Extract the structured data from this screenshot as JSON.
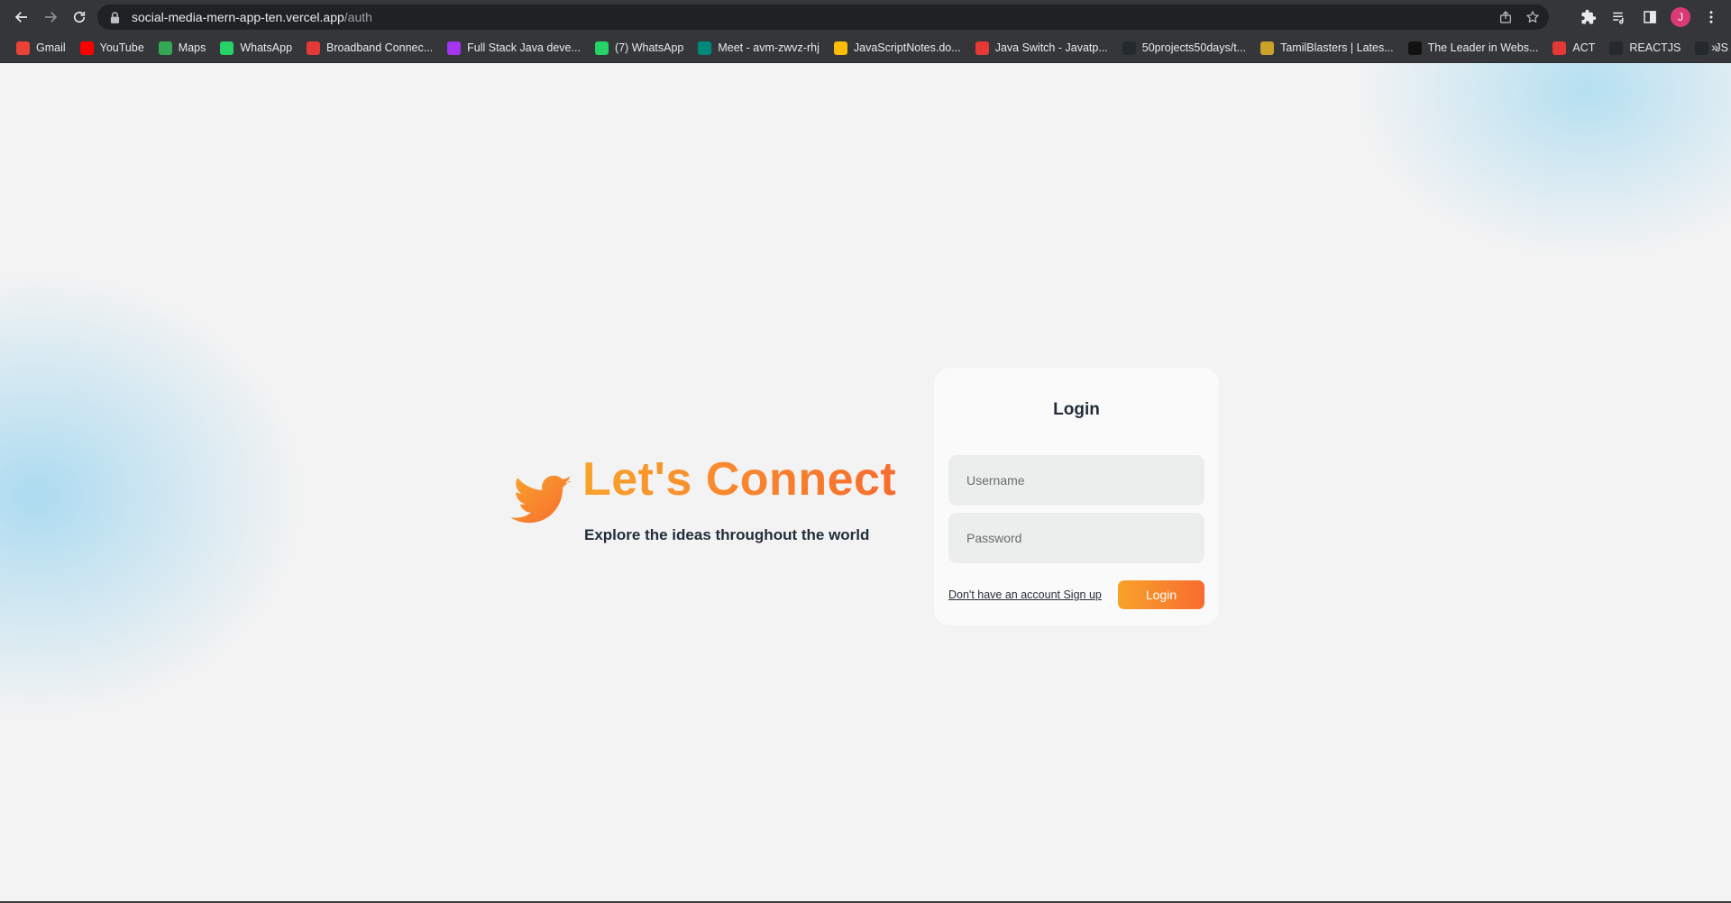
{
  "browser": {
    "url_host": "social-media-mern-app-ten.vercel.app",
    "url_path": "/auth",
    "profile_initial": "J",
    "bookmarks": [
      {
        "label": "Gmail",
        "icon": "gmail-icon",
        "color": "#ea4335"
      },
      {
        "label": "YouTube",
        "icon": "youtube-icon",
        "color": "#ff0000"
      },
      {
        "label": "Maps",
        "icon": "maps-icon",
        "color": "#34a853"
      },
      {
        "label": "WhatsApp",
        "icon": "whatsapp-icon",
        "color": "#25d366"
      },
      {
        "label": "Broadband Connec...",
        "icon": "broadband-icon",
        "color": "#e53935"
      },
      {
        "label": "Full Stack Java deve...",
        "icon": "udemy-icon",
        "color": "#a435f0"
      },
      {
        "label": "(7) WhatsApp",
        "icon": "whatsapp-icon",
        "color": "#25d366"
      },
      {
        "label": "Meet - avm-zwvz-rhj",
        "icon": "meet-icon",
        "color": "#00897b"
      },
      {
        "label": "JavaScriptNotes.do...",
        "icon": "drive-icon",
        "color": "#fbbc04"
      },
      {
        "label": "Java Switch - Javatp...",
        "icon": "javatpoint-icon",
        "color": "#e53935"
      },
      {
        "label": "50projects50days/t...",
        "icon": "github-icon",
        "color": "#24292e"
      },
      {
        "label": "TamilBlasters | Lates...",
        "icon": "tamilblasters-icon",
        "color": "#c9a227"
      },
      {
        "label": "The Leader in Webs...",
        "icon": "wix-icon",
        "color": "#111111"
      },
      {
        "label": "ACT",
        "icon": "act-icon",
        "color": "#e53935"
      },
      {
        "label": "REACTJS",
        "icon": "github-icon",
        "color": "#24292e"
      },
      {
        "label": "JS",
        "icon": "github-icon",
        "color": "#24292e"
      }
    ],
    "more_label": "»"
  },
  "brand": {
    "title": "Let's Connect",
    "subtitle": "Explore the ideas throughout the world",
    "accent_start": "#f9a22c",
    "accent_end": "#f76c2f"
  },
  "login": {
    "title": "Login",
    "username_placeholder": "Username",
    "password_placeholder": "Password",
    "signup_text": "Don't have an account Sign up",
    "submit_label": "Login"
  }
}
